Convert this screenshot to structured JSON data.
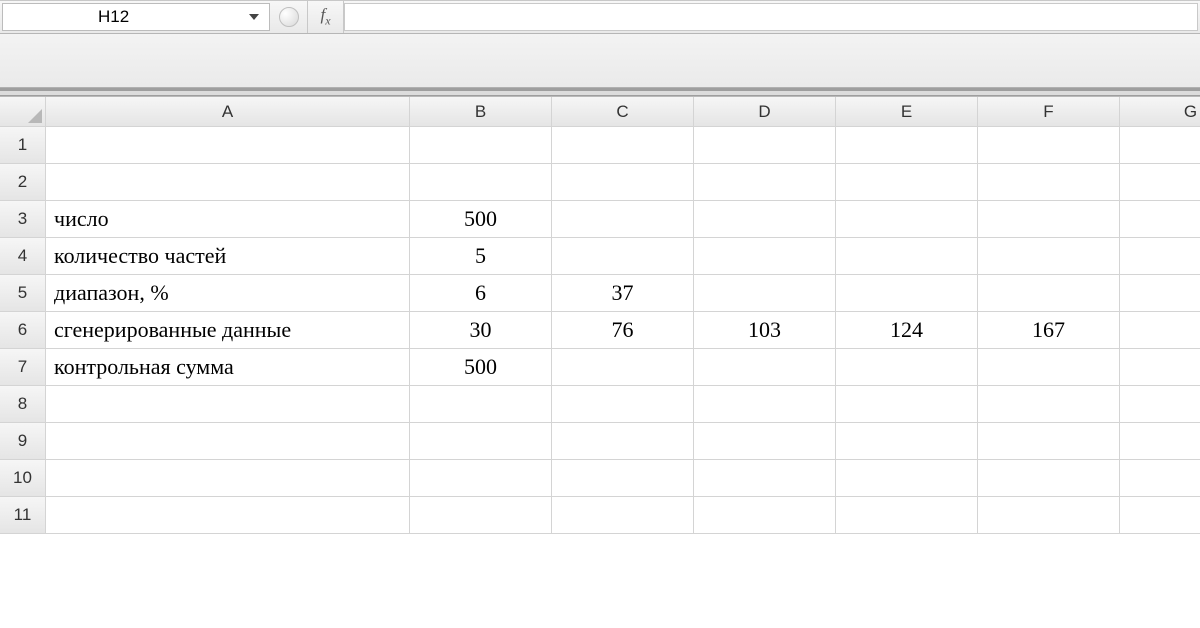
{
  "formula_bar": {
    "name_box_value": "H12",
    "fx_label": "f",
    "fx_sub": "x",
    "formula_value": ""
  },
  "columns": [
    "A",
    "B",
    "C",
    "D",
    "E",
    "F",
    "G"
  ],
  "row_numbers": [
    "1",
    "2",
    "3",
    "4",
    "5",
    "6",
    "7",
    "8",
    "9",
    "10",
    "11"
  ],
  "cells": {
    "A3": "число",
    "A4": "количество частей",
    "A5": "диапазон, %",
    "A6": "сгенерированные данные",
    "A7": "контрольная сумма",
    "B3": "500",
    "B4": "5",
    "B5": "6",
    "B6": "30",
    "B7": "500",
    "C5": "37",
    "C6": "76",
    "D6": "103",
    "E6": "124",
    "F6": "167"
  }
}
